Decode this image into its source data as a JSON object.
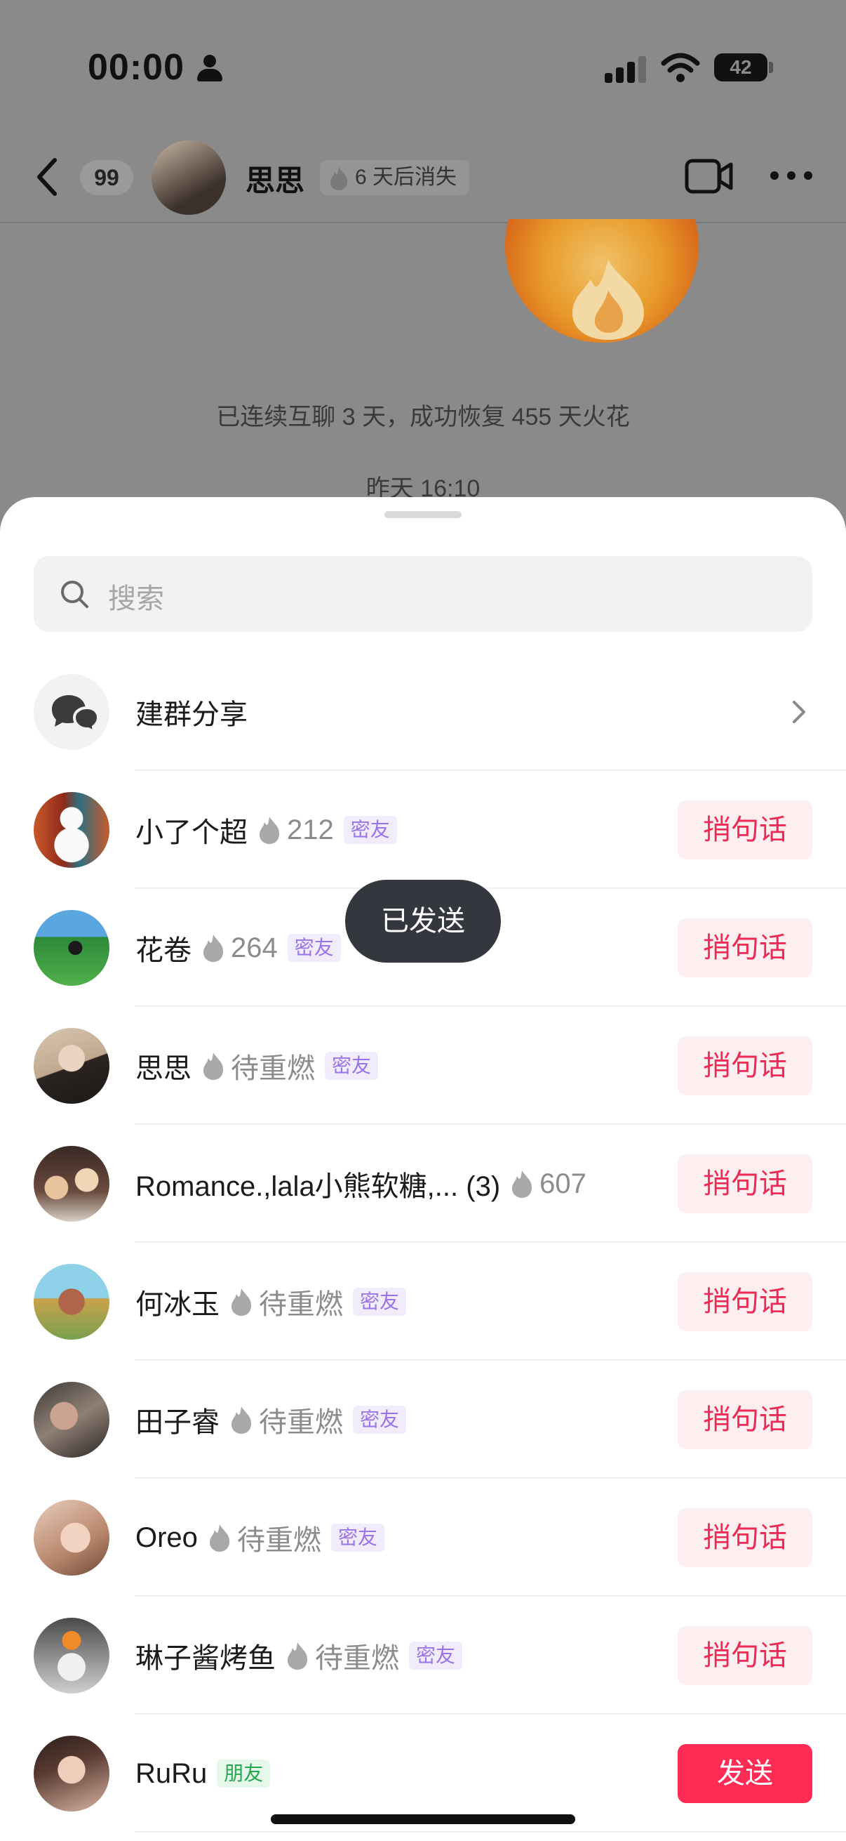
{
  "status_bar": {
    "time": "00:00",
    "battery": "42"
  },
  "chat_header": {
    "unread_count": "99",
    "name": "思思",
    "vanish_label": "6 天后消失"
  },
  "chat": {
    "streak_message": "已连续互聊 3 天，成功恢复 455 天火花",
    "timestamp": "昨天 16:10"
  },
  "share_sheet": {
    "search_placeholder": "搜索",
    "group_share_label": "建群分享",
    "toast": "已发送",
    "contacts": [
      {
        "name": "小了个超",
        "streak": "212",
        "badge": "密友",
        "badge_type": "close",
        "action": "捎句话",
        "action_style": "soft"
      },
      {
        "name": "花卷",
        "streak": "264",
        "badge": "密友",
        "badge_type": "close",
        "action": "捎句话",
        "action_style": "soft"
      },
      {
        "name": "思思",
        "streak": "待重燃",
        "badge": "密友",
        "badge_type": "close",
        "action": "捎句话",
        "action_style": "soft"
      },
      {
        "name": "Romance.,lala小熊软糖,... (3)",
        "streak": "607",
        "badge": "",
        "badge_type": "",
        "action": "捎句话",
        "action_style": "soft"
      },
      {
        "name": "何冰玉",
        "streak": "待重燃",
        "badge": "密友",
        "badge_type": "close",
        "action": "捎句话",
        "action_style": "soft"
      },
      {
        "name": "田子睿",
        "streak": "待重燃",
        "badge": "密友",
        "badge_type": "close",
        "action": "捎句话",
        "action_style": "soft"
      },
      {
        "name": "Oreo",
        "streak": "待重燃",
        "badge": "密友",
        "badge_type": "close",
        "action": "捎句话",
        "action_style": "soft"
      },
      {
        "name": "琳子酱烤鱼",
        "streak": "待重燃",
        "badge": "密友",
        "badge_type": "close",
        "action": "捎句话",
        "action_style": "soft"
      },
      {
        "name": "RuRu",
        "streak": "",
        "badge": "朋友",
        "badge_type": "friend",
        "action": "发送",
        "action_style": "primary"
      }
    ]
  },
  "colors": {
    "accent": "#fe2c55",
    "soft_button_bg": "#fdeef0",
    "close_badge": "#9a74e6",
    "friend_badge": "#27a84f"
  },
  "icons": [
    "person-icon",
    "signal-icon",
    "wifi-icon",
    "battery-icon",
    "back-icon",
    "flame-icon",
    "video-call-icon",
    "more-icon",
    "search-icon",
    "group-chat-icon",
    "chevron-right-icon"
  ]
}
